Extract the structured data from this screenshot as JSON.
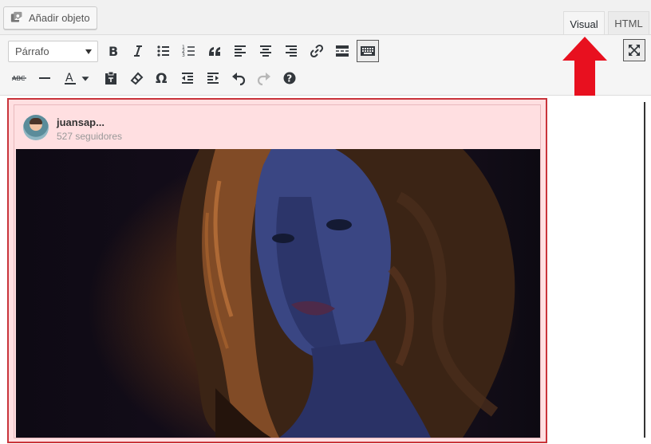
{
  "toolbar_top": {
    "add_media_label": "Añadir objeto",
    "tabs": [
      {
        "label": "Visual",
        "active": true
      },
      {
        "label": "HTML",
        "active": false
      }
    ]
  },
  "format_select": {
    "selected": "Párrafo"
  },
  "embed": {
    "username": "juansap...",
    "followers": "527 seguidores"
  },
  "colors": {
    "accent_arrow": "#e8101f",
    "embed_border": "#c9343b",
    "embed_background": "#ffdfe1"
  }
}
